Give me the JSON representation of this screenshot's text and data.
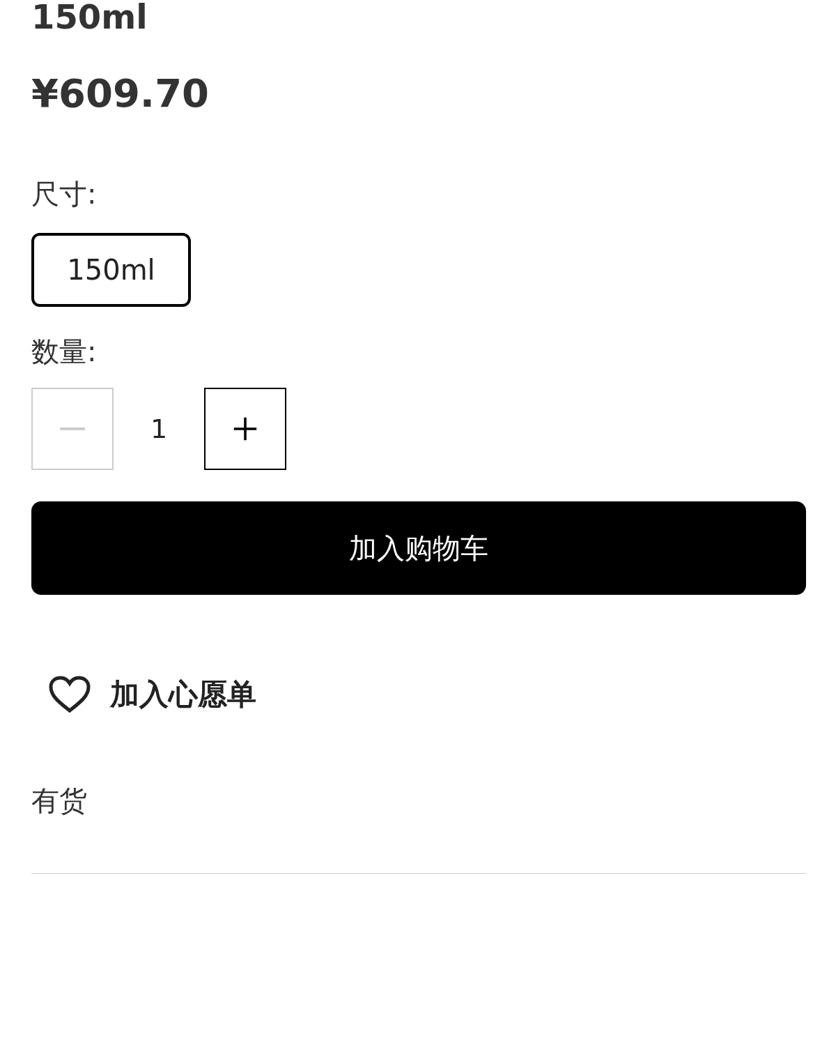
{
  "product": {
    "title": "150ml",
    "price": "¥609.70"
  },
  "size": {
    "label": "尺寸:",
    "options": [
      {
        "label": "150ml",
        "selected": true
      }
    ]
  },
  "quantity": {
    "label": "数量:",
    "value": "1",
    "decrease": {
      "disabled": true
    },
    "increase": {
      "disabled": false
    }
  },
  "add_to_cart": {
    "label": "加入购物车"
  },
  "wishlist": {
    "label": "加入心愿单"
  },
  "availability": "有货"
}
